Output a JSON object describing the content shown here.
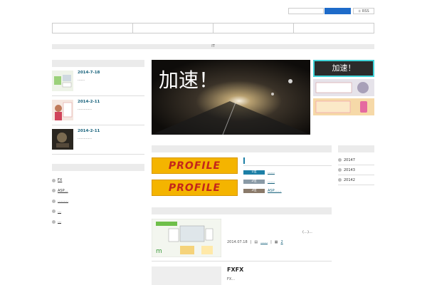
{
  "header": {
    "rss_label": "RSS",
    "topbar_text": "IT"
  },
  "recent_posts": [
    {
      "date": "2014-7-18",
      "sub": "……"
    },
    {
      "date": "2014-2-11",
      "sub": "…………"
    },
    {
      "date": "2014-2-11",
      "sub": "…………"
    }
  ],
  "categories": [
    {
      "label": "FX"
    },
    {
      "label": "ASP…"
    },
    {
      "label": "………"
    },
    {
      "label": "…"
    },
    {
      "label": "…"
    }
  ],
  "slider": {
    "caption": "加速！"
  },
  "side_banners": [
    {
      "label": "加速！"
    },
    {
      "label": ""
    },
    {
      "label": ""
    }
  ],
  "profiles": [
    {
      "label": "PROFILE"
    },
    {
      "label": "PROFILE"
    }
  ],
  "ranking": [
    {
      "badge": "1位",
      "text": "……",
      "color": "#1c7fa6"
    },
    {
      "badge": "2位",
      "text": "……",
      "color": "#8a9aa6"
    },
    {
      "badge": "3位",
      "text": "ASP……",
      "color": "#8a7a6a"
    }
  ],
  "archives": [
    {
      "label": "20147"
    },
    {
      "label": "20143"
    },
    {
      "label": "20142"
    }
  ],
  "cards": [
    {
      "excerpt": "(…)…",
      "date": "2014.07.18",
      "cat": "……",
      "comments": "2"
    },
    {
      "title": "FXFX",
      "excerpt": "FX…"
    }
  ],
  "colors": {
    "accent": "#1e6bc9",
    "link": "#15607a",
    "profile_bg": "#f4b400",
    "profile_text": "#c4261b"
  }
}
